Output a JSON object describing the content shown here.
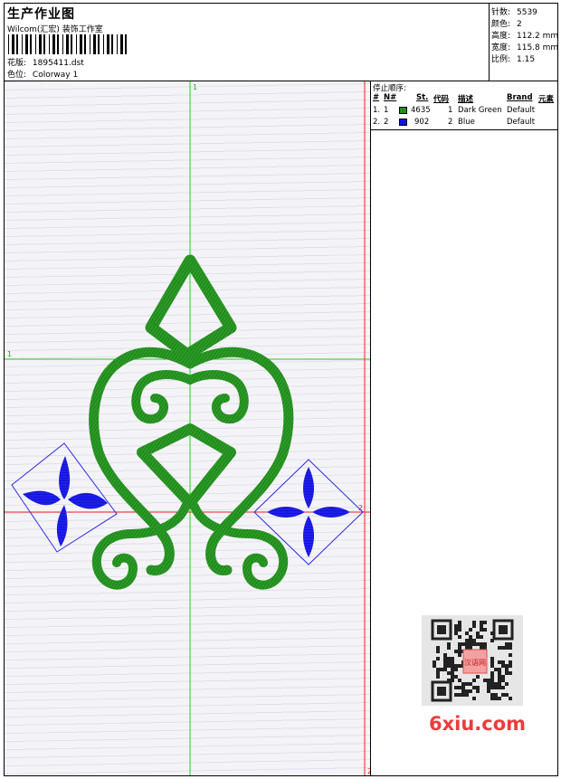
{
  "header": {
    "title": "生产作业图",
    "company": "Wilcom(汇宏) 装饰工作室",
    "design_label": "花版:",
    "design_value": "1895411.dst",
    "colorway_label": "色位:",
    "colorway_value": "Colorway 1"
  },
  "info": {
    "stitches_label": "针数:",
    "stitches_value": "5539",
    "colors_label": "颜色:",
    "colors_value": "2",
    "height_label": "高度:",
    "height_value": "112.2 mm",
    "width_label": "宽度:",
    "width_value": "115.8 mm",
    "scale_label": "比例:",
    "scale_value": "1.15"
  },
  "stop_sequence": {
    "title": "停止顺序:",
    "columns": [
      "#",
      "N#",
      "St.",
      "代码",
      "描述",
      "Brand",
      "元素"
    ],
    "rows": [
      {
        "num": "1.",
        "n": "1",
        "code_st": "4635",
        "code": "1",
        "description": "Dark Green",
        "brand": "Default",
        "color": "#1f8f1f"
      },
      {
        "num": "2.",
        "n": "2",
        "code_st": "902",
        "code": "2",
        "description": "Blue",
        "brand": "Default",
        "color": "#1010e0"
      }
    ]
  },
  "guides": {
    "green_v_label": "1",
    "green_h_label": "1",
    "red_h_label": "2",
    "red_v_label": "2"
  },
  "watermark": {
    "text": "6xiu.com",
    "qr_center_text": "汉语网"
  },
  "colors": {
    "green": "#22931e",
    "blue": "#1414e6",
    "guide_green": "#22cc22",
    "guide_red": "#ee2020",
    "watermark_red": "#ee3b3b"
  }
}
